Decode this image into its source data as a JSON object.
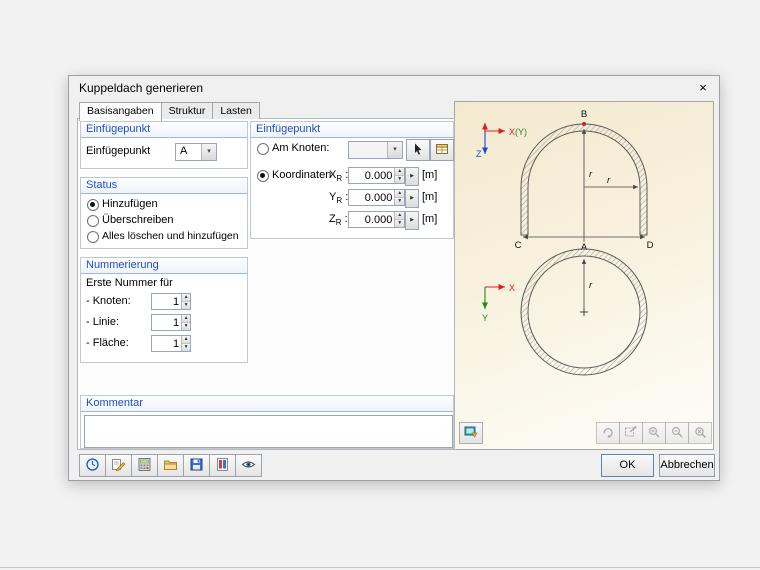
{
  "window": {
    "title": "Kuppeldach generieren"
  },
  "icons": {
    "close": "×",
    "dropdown": "▾",
    "spin_up": "▲",
    "spin_down": "▼",
    "more": "▶"
  },
  "tabs": [
    {
      "label": "Basisangaben",
      "active": true
    },
    {
      "label": "Struktur",
      "active": false
    },
    {
      "label": "Lasten",
      "active": false
    }
  ],
  "left": {
    "insert": {
      "title": "Einfügepunkt",
      "label": "Einfügepunkt",
      "value": "A"
    },
    "status": {
      "title": "Status",
      "options": [
        {
          "label": "Hinzufügen",
          "selected": true
        },
        {
          "label": "Überschreiben",
          "selected": false
        },
        {
          "label": "Alles löschen und hinzufügen",
          "selected": false
        }
      ]
    },
    "numbering": {
      "title": "Nummerierung",
      "subtitle": "Erste Nummer für",
      "rows": [
        {
          "label": "- Knoten:",
          "value": "1"
        },
        {
          "label": "- Linie:",
          "value": "1"
        },
        {
          "label": "- Fläche:",
          "value": "1"
        }
      ]
    }
  },
  "middle": {
    "title": "Einfügepunkt",
    "am_knoten": "Am Knoten:",
    "am_knoten_value": "",
    "am_knoten_selected": false,
    "koordinaten": "Koordinaten",
    "koordinaten_selected": true,
    "colon": ":",
    "coords": [
      {
        "axis": "X",
        "sub": "R",
        "value": "0.000",
        "unit": "[m]"
      },
      {
        "axis": "Y",
        "sub": "R",
        "value": "0.000",
        "unit": "[m]"
      },
      {
        "axis": "Z",
        "sub": "R",
        "value": "0.000",
        "unit": "[m]"
      }
    ]
  },
  "comment": {
    "title": "Kommentar",
    "value": ""
  },
  "graphic": {
    "section": {
      "apex_label": "B",
      "left_label": "C",
      "center_label": "A",
      "right_label": "D",
      "radius_vertical": "r",
      "radius_horizontal": "r",
      "axis_x": "X",
      "axis_x_paren": "(Y)",
      "axis_z": "Z"
    },
    "plan": {
      "radius": "r",
      "axis_x": "X",
      "axis_y": "Y"
    }
  },
  "footer": {
    "ok": "OK",
    "cancel": "Abbrechen"
  }
}
